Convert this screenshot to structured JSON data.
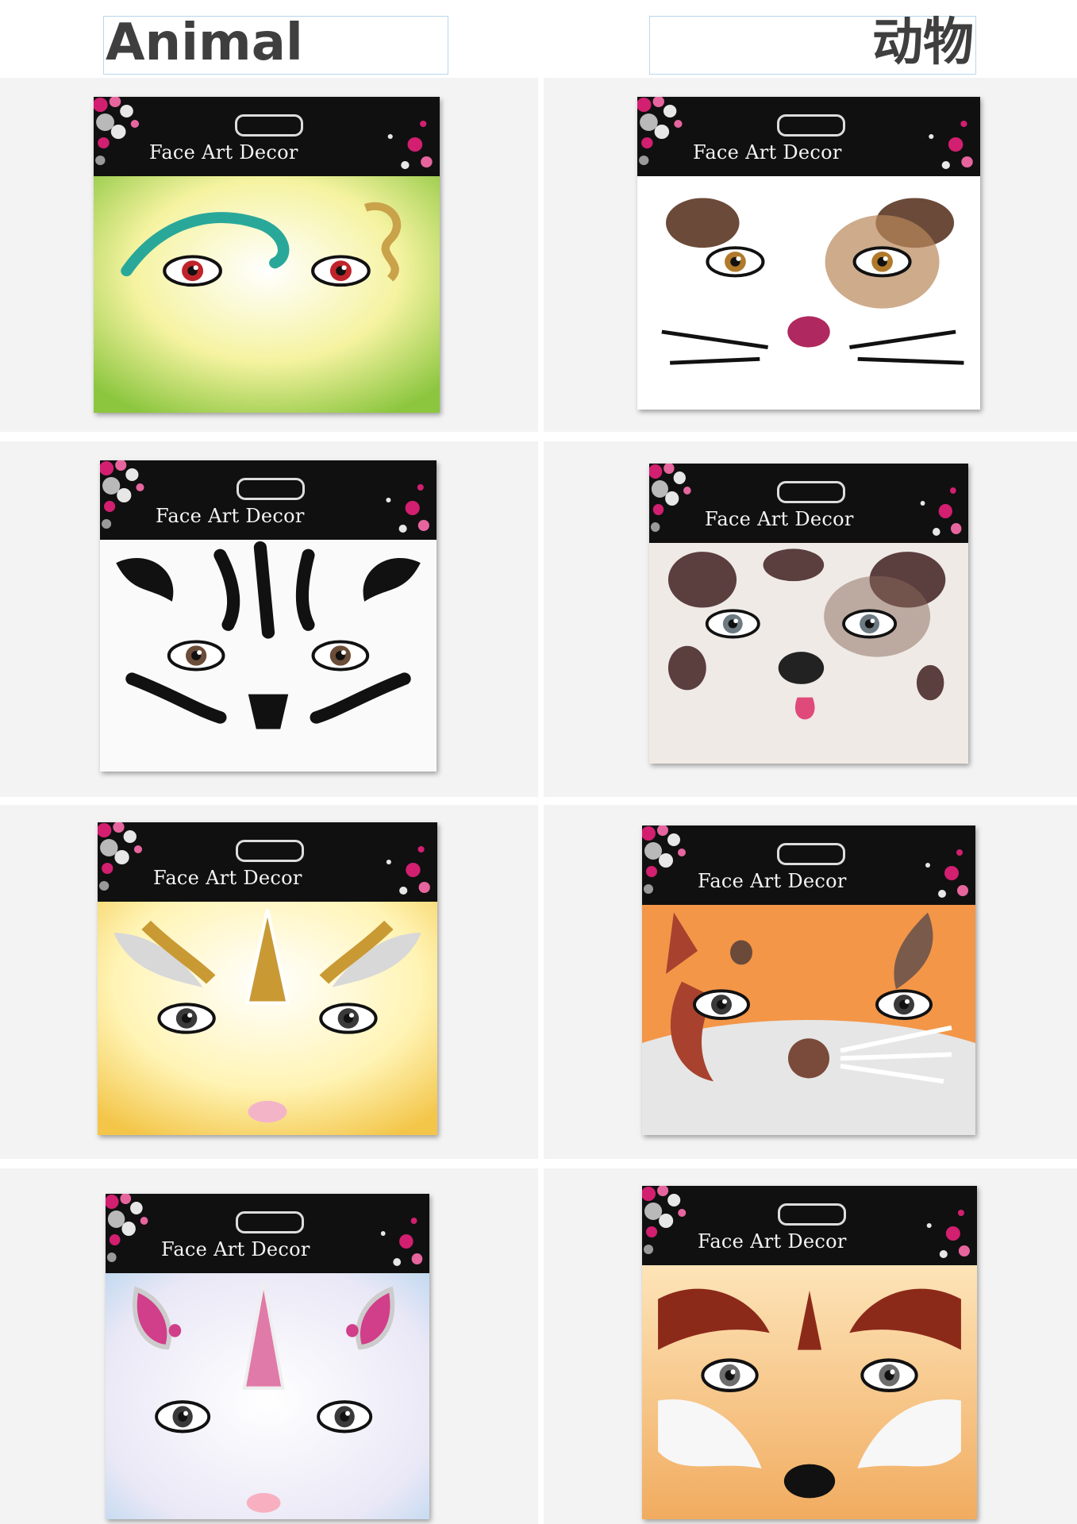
{
  "header": {
    "left_label": "Animal",
    "right_label": "动物"
  },
  "product_label": "Face Art Decor",
  "cards": [
    {
      "theme": "gecko",
      "colors": {
        "bg": "#dfe97a",
        "accent": "#29a89a",
        "eye": "#c0242a"
      }
    },
    {
      "theme": "puppy",
      "colors": {
        "bg": "#ffffff",
        "accent": "#6b4a3a",
        "eye": "#b07a2a"
      }
    },
    {
      "theme": "zebra",
      "colors": {
        "bg": "#fafafa",
        "accent": "#1a1a1a",
        "eye": "#6b4d38"
      }
    },
    {
      "theme": "dalmatian-dog",
      "colors": {
        "bg": "#efeae6",
        "accent": "#5b3e3e",
        "eye": "#6d7a82"
      }
    },
    {
      "theme": "golden-unicorn",
      "colors": {
        "bg": "#fff2a8",
        "accent": "#c99a34",
        "eye": "#3a3a3a"
      }
    },
    {
      "theme": "fox",
      "colors": {
        "bg": "#f39648",
        "accent": "#a8422e",
        "eye": "#3a3a3a"
      }
    },
    {
      "theme": "pink-unicorn",
      "colors": {
        "bg": "#f0eef7",
        "accent": "#d13e8a",
        "eye": "#3a3a3a"
      }
    },
    {
      "theme": "tiger-fox",
      "colors": {
        "bg": "#f6c07e",
        "accent": "#8c2a1a",
        "eye": "#6d6d6d"
      }
    }
  ]
}
